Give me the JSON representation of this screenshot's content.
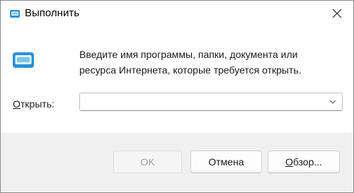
{
  "window": {
    "title": "Выполнить"
  },
  "description": {
    "line1": "Введите имя программы, папки, документа или",
    "line2": "ресурса Интернета, которые требуется открыть."
  },
  "open_field": {
    "label_mnemonic": "О",
    "label_rest": "ткрыть:",
    "value": ""
  },
  "buttons": {
    "ok": {
      "label": "OK",
      "enabled": false
    },
    "cancel": {
      "label": "Отмена",
      "enabled": true
    },
    "browse_mnemonic": "О",
    "browse_rest": "бзор..."
  },
  "icons": {
    "title": "run-app-icon",
    "main": "run-app-icon",
    "close": "close-icon",
    "dropdown": "chevron-down-icon"
  },
  "colors": {
    "accent": "#2b8fd6",
    "footer": "#f0f0f0",
    "disabled_text": "#a0a0a0"
  }
}
